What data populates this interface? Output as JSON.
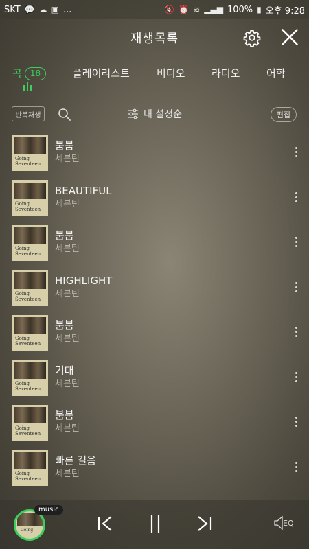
{
  "status": {
    "carrier": "SKT",
    "battery": "100%",
    "time": "오후 9:28",
    "dots": "..."
  },
  "header": {
    "title": "재생목록"
  },
  "tabs": [
    {
      "label": "곡",
      "badge": "18"
    },
    {
      "label": "플레이리스트"
    },
    {
      "label": "비디오"
    },
    {
      "label": "라디오"
    },
    {
      "label": "어학"
    }
  ],
  "toolbar": {
    "repeat_label": "반복재생",
    "sort_label": "내 설정순",
    "edit_label": "편집"
  },
  "album_art_text": {
    "line1": "Going",
    "line2": "Seventeen"
  },
  "songs": [
    {
      "title": "붐붐",
      "artist": "세븐틴"
    },
    {
      "title": "BEAUTIFUL",
      "artist": "세븐틴"
    },
    {
      "title": "붐붐",
      "artist": "세븐틴"
    },
    {
      "title": "HIGHLIGHT",
      "artist": "세븐틴"
    },
    {
      "title": "붐붐",
      "artist": "세븐틴"
    },
    {
      "title": "기대",
      "artist": "세븐틴"
    },
    {
      "title": "붐붐",
      "artist": "세븐틴"
    },
    {
      "title": "빠른 걸음",
      "artist": "세븐틴"
    }
  ],
  "player": {
    "tag": "music",
    "eq_label": "EQ"
  },
  "colors": {
    "accent": "#3ad05b"
  }
}
